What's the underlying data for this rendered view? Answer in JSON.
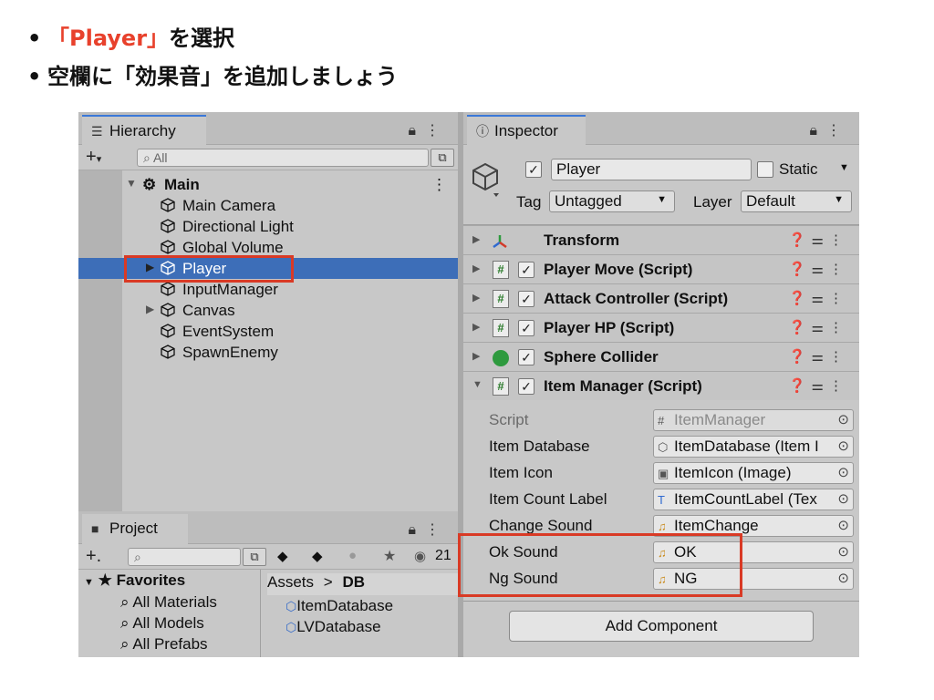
{
  "slide": {
    "bullet1": {
      "dot": "•",
      "highlight": "「Player」",
      "rest": "を選択"
    },
    "bullet2": {
      "dot": "•",
      "text": "空欄に「効果音」を追加しましょう"
    }
  },
  "hierarchy": {
    "tab_label": "Hierarchy",
    "search_placeholder": "All",
    "scene": "Main",
    "items": [
      {
        "label": "Main Camera",
        "expandable": false,
        "selected": false
      },
      {
        "label": "Directional Light",
        "expandable": false,
        "selected": false
      },
      {
        "label": "Global Volume",
        "expandable": false,
        "selected": false
      },
      {
        "label": "Player",
        "expandable": true,
        "selected": true
      },
      {
        "label": "InputManager",
        "expandable": false,
        "selected": false
      },
      {
        "label": "Canvas",
        "expandable": true,
        "selected": false
      },
      {
        "label": "EventSystem",
        "expandable": false,
        "selected": false
      },
      {
        "label": "SpawnEnemy",
        "expandable": false,
        "selected": false
      }
    ]
  },
  "project": {
    "tab_label": "Project",
    "hidden_count": "21",
    "favorites": {
      "label": "Favorites",
      "items": [
        "All Materials",
        "All Models",
        "All Prefabs"
      ]
    },
    "breadcrumb": {
      "root": "Assets",
      "sep": ">",
      "current": "DB"
    },
    "assets": [
      "ItemDatabase",
      "LVDatabase"
    ]
  },
  "inspector": {
    "tab_label": "Inspector",
    "object_name": "Player",
    "static_label": "Static",
    "tag_label": "Tag",
    "tag_value": "Untagged",
    "layer_label": "Layer",
    "layer_value": "Default",
    "components": [
      {
        "name": "Transform",
        "type": "transform",
        "expanded": false
      },
      {
        "name": "Player Move (Script)",
        "type": "script",
        "expanded": false
      },
      {
        "name": "Attack Controller (Script)",
        "type": "script",
        "expanded": false
      },
      {
        "name": "Player HP (Script)",
        "type": "script",
        "expanded": false
      },
      {
        "name": "Sphere Collider",
        "type": "collider",
        "expanded": false
      },
      {
        "name": "Item Manager (Script)",
        "type": "script",
        "expanded": true
      }
    ],
    "properties": [
      {
        "label": "Script",
        "value": "ItemManager",
        "icon": "#",
        "dim": true
      },
      {
        "label": "Item Database",
        "value": "ItemDatabase (Item I",
        "icon": "⬡",
        "dim": false
      },
      {
        "label": "Item Icon",
        "value": "ItemIcon (Image)",
        "icon": "▣",
        "dim": false
      },
      {
        "label": "Item Count Label",
        "value": "ItemCountLabel (Tex",
        "icon": "T",
        "dim": false
      },
      {
        "label": "Change Sound",
        "value": "ItemChange",
        "icon": "♫",
        "dim": false
      },
      {
        "label": "Ok Sound",
        "value": "OK",
        "icon": "♫",
        "dim": false
      },
      {
        "label": "Ng Sound",
        "value": "NG",
        "icon": "♫",
        "dim": false
      }
    ],
    "add_component_label": "Add Component"
  },
  "colors": {
    "highlight_red": "#e8412c",
    "selection_blue": "#3d6eb8",
    "annotation_red": "#d93a25"
  }
}
